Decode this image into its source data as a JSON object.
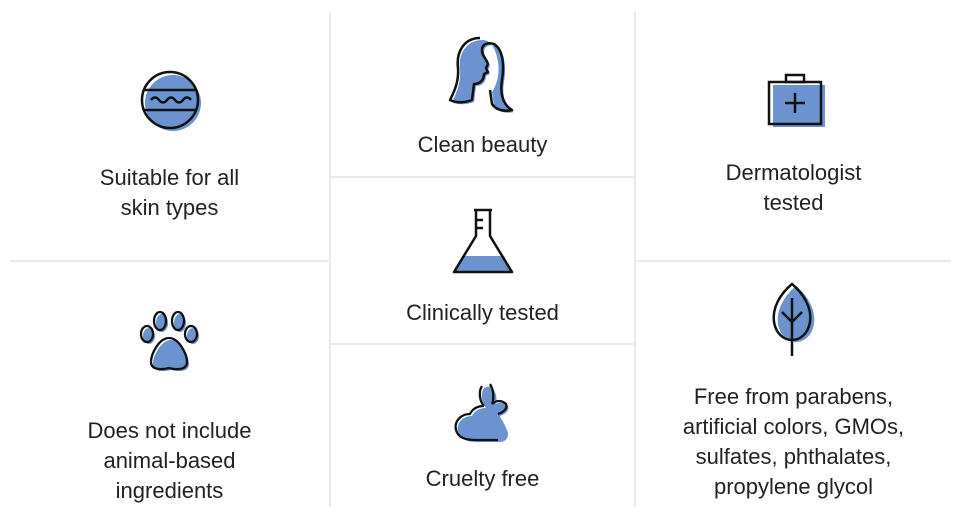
{
  "colors": {
    "accent": "#6a93cf",
    "stroke": "#111111",
    "divider": "#ece9e4"
  },
  "features": [
    {
      "icon": "water-waves-icon",
      "lines": [
        "Suitable for all",
        "skin types"
      ]
    },
    {
      "icon": "woman-silhouette-icon",
      "lines": [
        "Clean beauty"
      ]
    },
    {
      "icon": "medical-kit-icon",
      "lines": [
        "Dermatologist",
        "tested"
      ]
    },
    {
      "icon": "lab-flask-icon",
      "lines": [
        "Clinically tested"
      ]
    },
    {
      "icon": "paw-print-icon",
      "lines": [
        "Does not include",
        "animal-based",
        "ingredients"
      ]
    },
    {
      "icon": "rabbit-icon",
      "lines": [
        "Cruelty free"
      ]
    },
    {
      "icon": "leaf-icon",
      "lines": [
        "Free from parabens,",
        "artificial colors, GMOs,",
        "sulfates, phthalates,",
        "propylene glycol"
      ]
    }
  ]
}
